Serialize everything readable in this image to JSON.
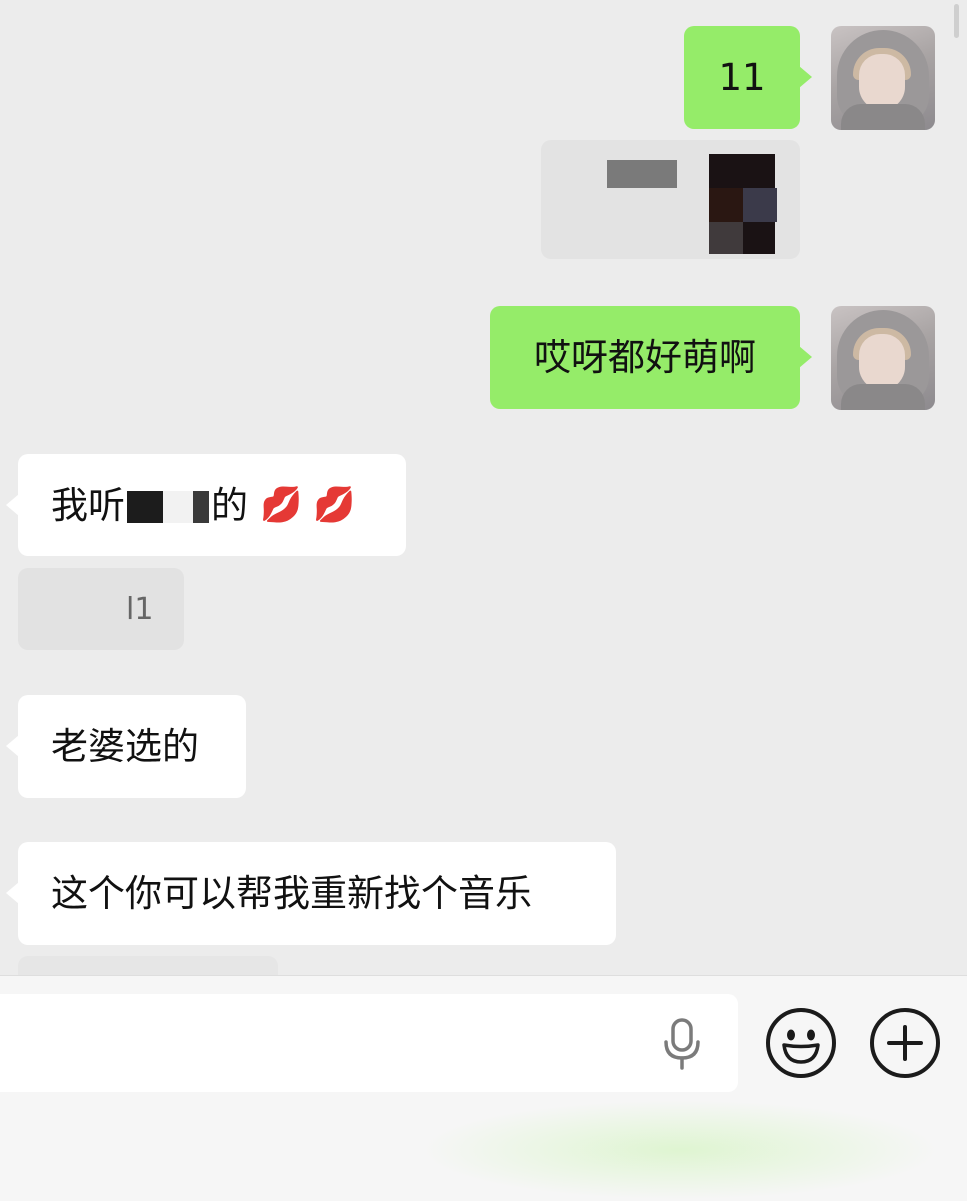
{
  "messages": [
    {
      "side": "out",
      "text": "11"
    },
    {
      "side": "out",
      "text": "哎呀都好萌啊"
    },
    {
      "side": "in",
      "text_before": "我听",
      "text_after": "的",
      "emoji": "💋 💋"
    },
    {
      "side": "in",
      "text": "l1"
    },
    {
      "side": "in",
      "text": "老婆选的"
    },
    {
      "side": "in",
      "text": "这个你可以帮我重新找个音乐"
    }
  ],
  "icons": {
    "voice": "microphone-icon",
    "emoji": "emoji-icon",
    "more": "plus-icon"
  },
  "colors": {
    "outgoing_bubble": "#95ec69",
    "incoming_bubble": "#ffffff",
    "chat_background": "#ececec"
  }
}
